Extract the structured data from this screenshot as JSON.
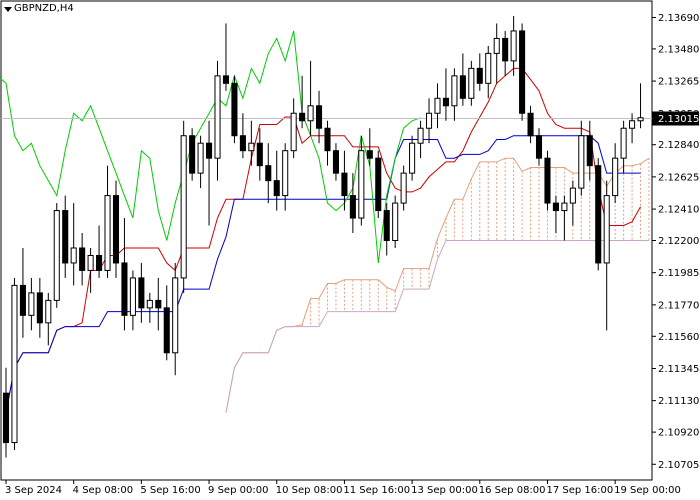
{
  "symbol": "GBPNZD,H4",
  "current_price_label": "2.13015",
  "colors": {
    "bull": "#000000",
    "bear": "#000000",
    "tenkan": "#cc0000",
    "kijun": "#0000cc",
    "chikou": "#00cc00",
    "senkou_a": "#e3a07d",
    "senkou_b": "#c9a7c9",
    "price_line": "#c0c0c0"
  },
  "chart_data": {
    "type": "candlestick",
    "title": "",
    "indicator": "Ichimoku Kinko Hyo",
    "ylim": [
      2.106,
      2.138
    ],
    "yticks": [
      "2.13690",
      "2.13480",
      "2.13265",
      "2.13050",
      "2.12840",
      "2.12625",
      "2.12410",
      "2.12200",
      "2.11985",
      "2.11770",
      "2.11560",
      "2.11345",
      "2.11130",
      "2.10920",
      "2.10705"
    ],
    "ytick_values": [
      2.1369,
      2.1348,
      2.13265,
      2.1305,
      2.1284,
      2.12625,
      2.1241,
      2.122,
      2.11985,
      2.1177,
      2.1156,
      2.11345,
      2.1113,
      2.1092,
      2.10705
    ],
    "xticks": [
      "3 Sep 2024",
      "4 Sep 08:00",
      "5 Sep 16:00",
      "9 Sep 00:00",
      "10 Sep 08:00",
      "11 Sep 16:00",
      "13 Sep 00:00",
      "16 Sep 08:00",
      "17 Sep 16:00",
      "19 Sep 00:00"
    ],
    "xtick_index": [
      0,
      8,
      16,
      24,
      32,
      40,
      48,
      56,
      64,
      72
    ],
    "current_price": 2.13015,
    "candles": [
      [
        2.1118,
        2.1135,
        2.1075,
        2.1085
      ],
      [
        2.1085,
        2.1195,
        2.108,
        2.119
      ],
      [
        2.119,
        2.1215,
        2.1155,
        2.117
      ],
      [
        2.117,
        2.1195,
        2.116,
        2.1185
      ],
      [
        2.1185,
        2.1195,
        2.1155,
        2.1165
      ],
      [
        2.1165,
        2.1185,
        2.115,
        2.118
      ],
      [
        2.118,
        2.1245,
        2.1175,
        2.124
      ],
      [
        2.124,
        2.125,
        2.1195,
        2.1205
      ],
      [
        2.1205,
        2.1245,
        2.119,
        2.1215
      ],
      [
        2.1215,
        2.1225,
        2.119,
        2.12
      ],
      [
        2.12,
        2.1215,
        2.1185,
        2.121
      ],
      [
        2.121,
        2.123,
        2.1195,
        2.12
      ],
      [
        2.12,
        2.127,
        2.1195,
        2.125
      ],
      [
        2.125,
        2.126,
        2.1195,
        2.1205
      ],
      [
        2.1205,
        2.1235,
        2.116,
        2.117
      ],
      [
        2.117,
        2.12,
        2.116,
        2.1195
      ],
      [
        2.1195,
        2.1205,
        2.1165,
        2.1175
      ],
      [
        2.1175,
        2.1185,
        2.1165,
        2.118
      ],
      [
        2.118,
        2.1195,
        2.116,
        2.1175
      ],
      [
        2.1175,
        2.119,
        2.114,
        2.1145
      ],
      [
        2.1145,
        2.1205,
        2.113,
        2.1195
      ],
      [
        2.1195,
        2.13,
        2.1185,
        2.129
      ],
      [
        2.129,
        2.1295,
        2.126,
        2.1265
      ],
      [
        2.1265,
        2.129,
        2.1255,
        2.1285
      ],
      [
        2.1285,
        2.13,
        2.123,
        2.1275
      ],
      [
        2.1275,
        2.134,
        2.126,
        2.133
      ],
      [
        2.133,
        2.1365,
        2.132,
        2.1325
      ],
      [
        2.1325,
        2.133,
        2.1285,
        2.129
      ],
      [
        2.129,
        2.1305,
        2.1275,
        2.128
      ],
      [
        2.128,
        2.13,
        2.127,
        2.1285
      ],
      [
        2.1285,
        2.1295,
        2.126,
        2.127
      ],
      [
        2.127,
        2.1285,
        2.1245,
        2.126
      ],
      [
        2.126,
        2.128,
        2.124,
        2.125
      ],
      [
        2.125,
        2.1285,
        2.124,
        2.128
      ],
      [
        2.128,
        2.1315,
        2.1275,
        2.1305
      ],
      [
        2.1305,
        2.133,
        2.1295,
        2.13
      ],
      [
        2.13,
        2.134,
        2.129,
        2.131
      ],
      [
        2.131,
        2.132,
        2.1285,
        2.1295
      ],
      [
        2.1295,
        2.13,
        2.127,
        2.128
      ],
      [
        2.128,
        2.1285,
        2.126,
        2.1265
      ],
      [
        2.1265,
        2.128,
        2.124,
        2.125
      ],
      [
        2.125,
        2.1265,
        2.1225,
        2.1235
      ],
      [
        2.1235,
        2.129,
        2.123,
        2.128
      ],
      [
        2.128,
        2.1295,
        2.127,
        2.1275
      ],
      [
        2.1275,
        2.128,
        2.1235,
        2.124
      ],
      [
        2.124,
        2.1245,
        2.121,
        2.122
      ],
      [
        2.122,
        2.125,
        2.1215,
        2.1245
      ],
      [
        2.1245,
        2.127,
        2.124,
        2.1265
      ],
      [
        2.1265,
        2.129,
        2.126,
        2.1285
      ],
      [
        2.1285,
        2.13,
        2.1275,
        2.1295
      ],
      [
        2.1295,
        2.1315,
        2.1285,
        2.1305
      ],
      [
        2.1305,
        2.1325,
        2.1295,
        2.1315
      ],
      [
        2.1315,
        2.1335,
        2.13,
        2.131
      ],
      [
        2.131,
        2.1335,
        2.13,
        2.133
      ],
      [
        2.133,
        2.1345,
        2.131,
        2.1315
      ],
      [
        2.1315,
        2.134,
        2.131,
        2.1335
      ],
      [
        2.1335,
        2.1345,
        2.132,
        2.1325
      ],
      [
        2.1325,
        2.135,
        2.1315,
        2.1345
      ],
      [
        2.1345,
        2.1365,
        2.1325,
        2.1355
      ],
      [
        2.1355,
        2.136,
        2.133,
        2.134
      ],
      [
        2.134,
        2.137,
        2.133,
        2.136
      ],
      [
        2.136,
        2.1365,
        2.13,
        2.1305
      ],
      [
        2.1305,
        2.131,
        2.1285,
        2.129
      ],
      [
        2.129,
        2.1295,
        2.127,
        2.1275
      ],
      [
        2.1275,
        2.128,
        2.124,
        2.1245
      ],
      [
        2.1245,
        2.125,
        2.1225,
        2.124
      ],
      [
        2.124,
        2.125,
        2.122,
        2.1245
      ],
      [
        2.1245,
        2.126,
        2.123,
        2.1255
      ],
      [
        2.1255,
        2.13,
        2.125,
        2.129
      ],
      [
        2.129,
        2.13,
        2.126,
        2.127
      ],
      [
        2.127,
        2.1275,
        2.12,
        2.1205
      ],
      [
        2.1205,
        2.126,
        2.116,
        2.125
      ],
      [
        2.125,
        2.1285,
        2.1245,
        2.1275
      ],
      [
        2.1275,
        2.13,
        2.1265,
        2.1295
      ],
      [
        2.1295,
        2.1305,
        2.1285,
        2.13
      ],
      [
        2.13,
        2.1325,
        2.1295,
        2.1302
      ]
    ]
  }
}
